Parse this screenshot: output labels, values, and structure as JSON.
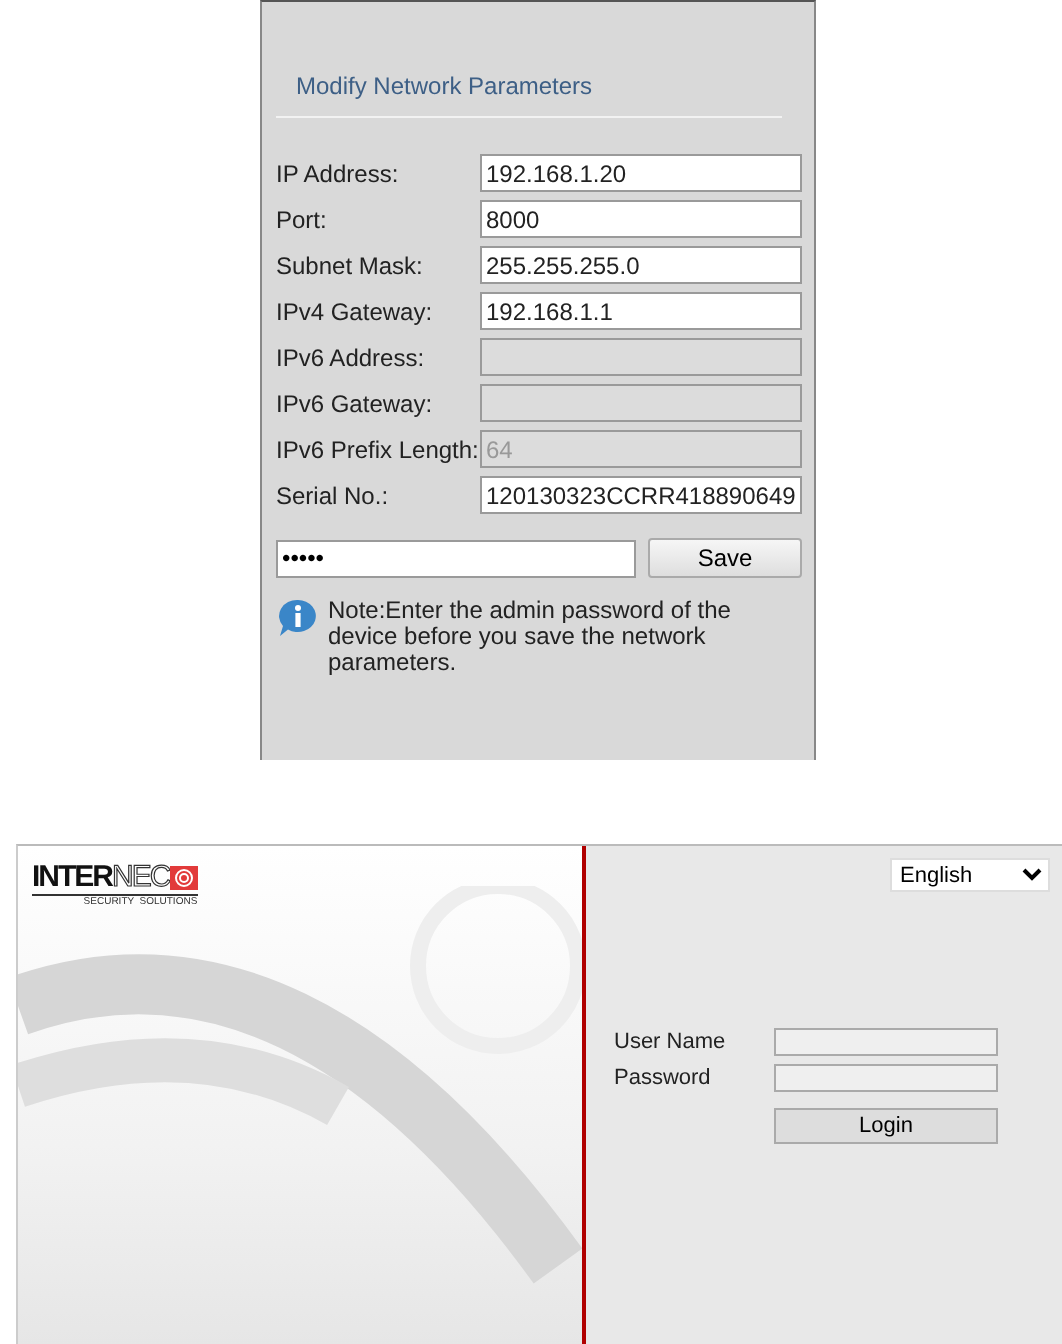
{
  "network_dialog": {
    "title": "Modify Network Parameters",
    "fields": [
      {
        "label": "IP Address:",
        "value": "192.168.1.20",
        "disabled": false
      },
      {
        "label": "Port:",
        "value": "8000",
        "disabled": false
      },
      {
        "label": "Subnet Mask:",
        "value": "255.255.255.0",
        "disabled": false
      },
      {
        "label": "IPv4 Gateway:",
        "value": "192.168.1.1",
        "disabled": false
      },
      {
        "label": "IPv6 Address:",
        "disabled": true
      },
      {
        "label": "IPv6 Gateway:",
        "disabled": true
      },
      {
        "label": "IPv6 Prefix Length:",
        "value": "64",
        "disabled": true
      },
      {
        "label": "Serial No.:",
        "value": "120130323CCRR418890649",
        "disabled": false
      }
    ],
    "password": {
      "value": "•••••"
    },
    "save_button": "Save",
    "note": "Note:Enter the admin password of the device before you save the network parameters."
  },
  "login_page": {
    "logo": {
      "bold": "INTER",
      "outline": "NEC",
      "tagline": "SECURITY  SOLUTIONS"
    },
    "language": "English",
    "fields": [
      {
        "label": "User Name"
      },
      {
        "label": "Password"
      }
    ],
    "login_button": "Login"
  }
}
